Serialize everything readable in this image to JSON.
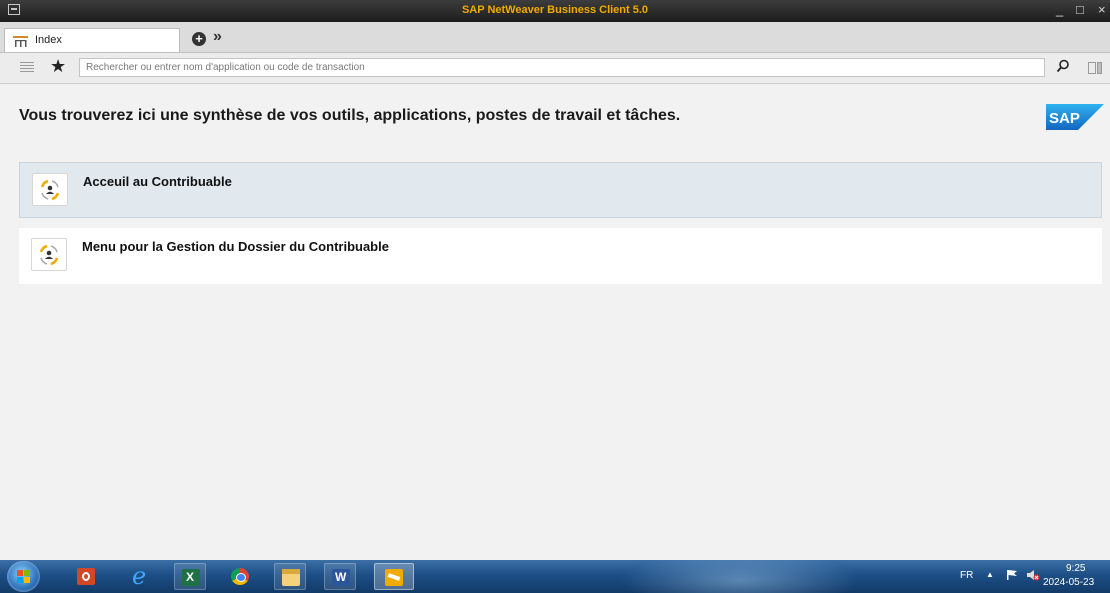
{
  "window": {
    "title": "SAP NetWeaver Business Client 5.0",
    "controls": {
      "minimize": "_",
      "maximize": "□",
      "close": "×"
    }
  },
  "tabs": [
    {
      "label": "Index",
      "icon": "sitemap-icon",
      "active": true
    }
  ],
  "tabbar": {
    "add_icon": "plus-circle-icon",
    "more_icon": "double-chevron-right-icon"
  },
  "toolbar": {
    "search_placeholder": "Rechercher ou entrer nom d'application ou code de transaction",
    "search_value": ""
  },
  "main": {
    "heading": "Vous trouverez ici une synthèse de vos outils, applications, postes de travail et tâches.",
    "logo": "SAP",
    "items": [
      {
        "label": "Acceuil au Contribuable",
        "icon": "role-person-icon",
        "selected": true
      },
      {
        "label": "Menu pour la Gestion du Dossier du Contribuable",
        "icon": "role-person-icon",
        "selected": false
      }
    ]
  },
  "taskbar": {
    "apps": [
      "powerpoint-icon",
      "internet-explorer-icon",
      "excel-icon",
      "chrome-icon",
      "file-explorer-icon",
      "word-icon",
      "sap-business-client-icon"
    ],
    "tray": {
      "language": "FR",
      "time": "9:25",
      "date": "2024-05-23"
    }
  },
  "colors": {
    "title_text": "#f0ab00",
    "selected_item_bg": "#e1e9ef",
    "sap_logo_blue": "#1a7fd6",
    "taskbar": "#1d4f86"
  }
}
